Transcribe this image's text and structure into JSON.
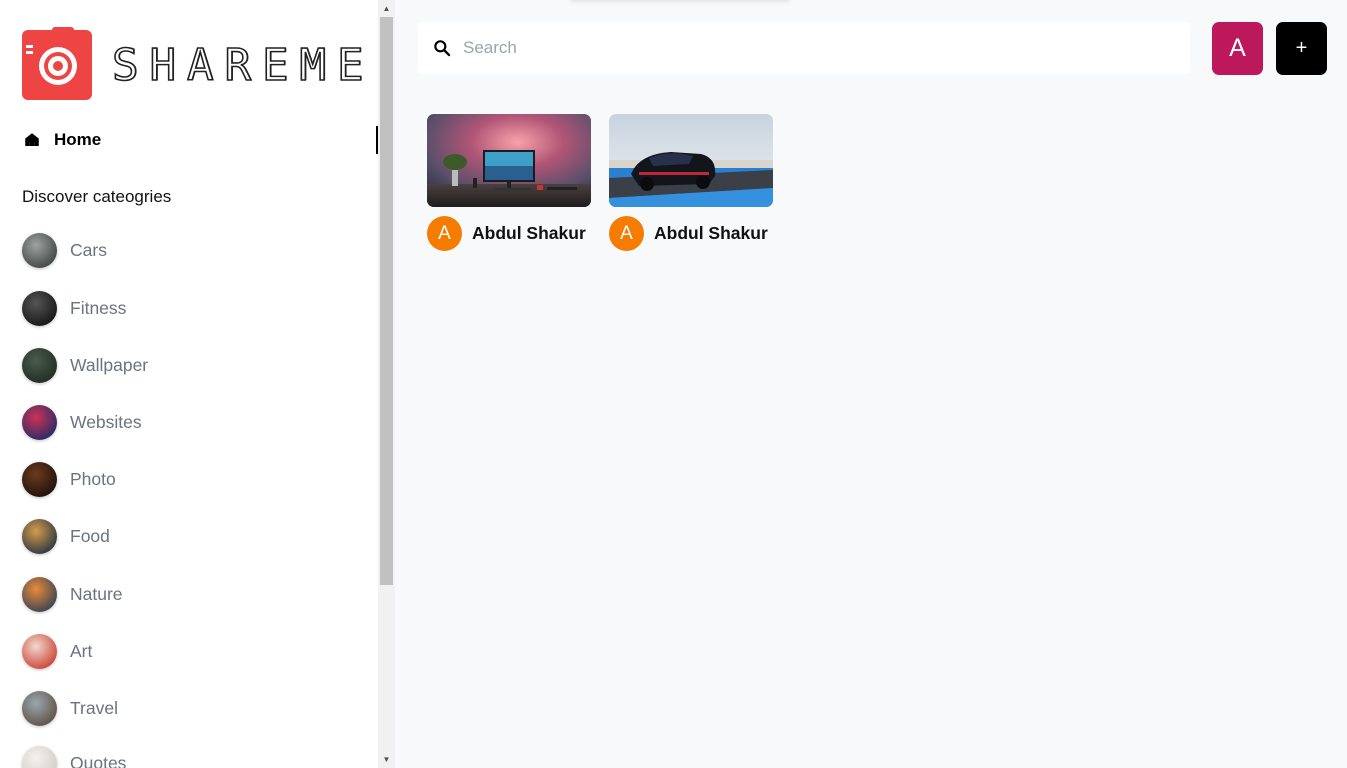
{
  "app": {
    "logo_text": "SHAREME"
  },
  "sidebar": {
    "home_label": "Home",
    "discover_heading": "Discover cateogries",
    "categories": [
      {
        "label": "Cars",
        "thumb_colors": [
          "#9ca3a1",
          "#3b3f3c"
        ]
      },
      {
        "label": "Fitness",
        "thumb_colors": [
          "#555555",
          "#111111"
        ]
      },
      {
        "label": "Wallpaper",
        "thumb_colors": [
          "#4b5b4d",
          "#1d2a22"
        ]
      },
      {
        "label": "Websites",
        "thumb_colors": [
          "#cc3355",
          "#1e2a6a"
        ]
      },
      {
        "label": "Photo",
        "thumb_colors": [
          "#6b3b20",
          "#1a0e08"
        ]
      },
      {
        "label": "Food",
        "thumb_colors": [
          "#d39b4e",
          "#203040"
        ]
      },
      {
        "label": "Nature",
        "thumb_colors": [
          "#e88a3c",
          "#2c3f52"
        ]
      },
      {
        "label": "Art",
        "thumb_colors": [
          "#f2d7d0",
          "#c83a2a"
        ]
      },
      {
        "label": "Travel",
        "thumb_colors": [
          "#9aa7b0",
          "#5b4b3d"
        ]
      },
      {
        "label": "Quotes",
        "thumb_colors": [
          "#f4f2ee",
          "#cfcac2"
        ]
      }
    ]
  },
  "header": {
    "search_placeholder": "Search",
    "user_initial": "A",
    "add_label": "+"
  },
  "pins": [
    {
      "author": "Abdul Shakur",
      "author_initial": "A",
      "image": "desk-setup"
    },
    {
      "author": "Abdul Shakur",
      "author_initial": "A",
      "image": "sports-car"
    }
  ],
  "colors": {
    "logo_red": "#ef4444",
    "avatar_pink": "#be185d",
    "author_orange": "#f57c00",
    "main_bg": "#f8f9fb"
  }
}
